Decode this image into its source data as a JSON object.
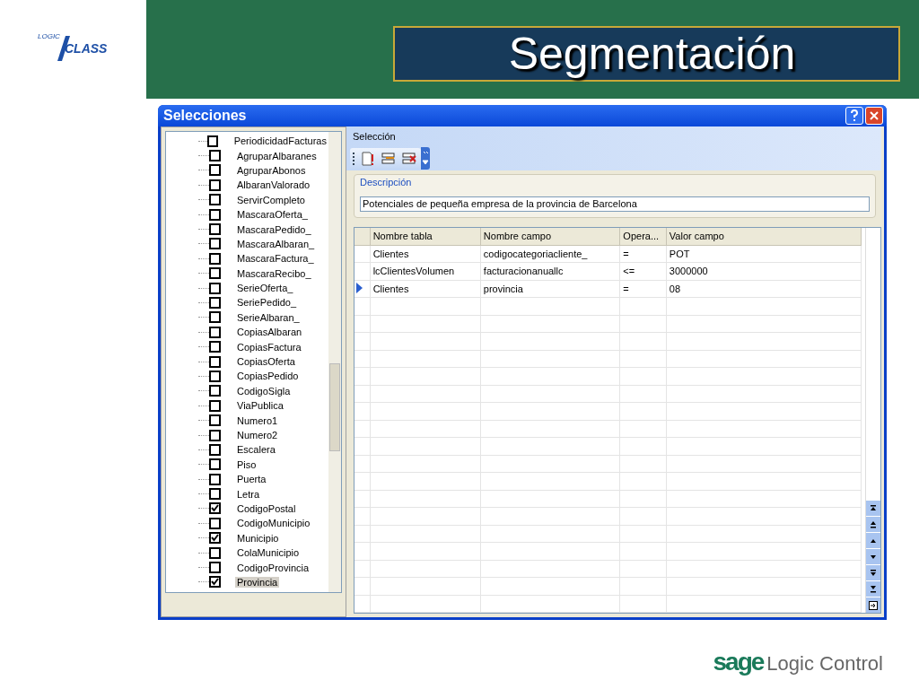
{
  "logo": {
    "top": "LOGIC",
    "main": "CLASS"
  },
  "slide_title": "Segmentación",
  "window": {
    "title": "Selecciones"
  },
  "tree": {
    "items": [
      {
        "label": "PeriodicidadFacturas",
        "checked": false,
        "selected": false
      },
      {
        "label": "AgruparAlbaranes",
        "checked": false,
        "selected": false
      },
      {
        "label": "AgruparAbonos",
        "checked": false,
        "selected": false
      },
      {
        "label": "AlbaranValorado",
        "checked": false,
        "selected": false
      },
      {
        "label": "ServirCompleto",
        "checked": false,
        "selected": false
      },
      {
        "label": "MascaraOferta_",
        "checked": false,
        "selected": false
      },
      {
        "label": "MascaraPedido_",
        "checked": false,
        "selected": false
      },
      {
        "label": "MascaraAlbaran_",
        "checked": false,
        "selected": false
      },
      {
        "label": "MascaraFactura_",
        "checked": false,
        "selected": false
      },
      {
        "label": "MascaraRecibo_",
        "checked": false,
        "selected": false
      },
      {
        "label": "SerieOferta_",
        "checked": false,
        "selected": false
      },
      {
        "label": "SeriePedido_",
        "checked": false,
        "selected": false
      },
      {
        "label": "SerieAlbaran_",
        "checked": false,
        "selected": false
      },
      {
        "label": "CopiasAlbaran",
        "checked": false,
        "selected": false
      },
      {
        "label": "CopiasFactura",
        "checked": false,
        "selected": false
      },
      {
        "label": "CopiasOferta",
        "checked": false,
        "selected": false
      },
      {
        "label": "CopiasPedido",
        "checked": false,
        "selected": false
      },
      {
        "label": "CodigoSigla",
        "checked": false,
        "selected": false
      },
      {
        "label": "ViaPublica",
        "checked": false,
        "selected": false
      },
      {
        "label": "Numero1",
        "checked": false,
        "selected": false
      },
      {
        "label": "Numero2",
        "checked": false,
        "selected": false
      },
      {
        "label": "Escalera",
        "checked": false,
        "selected": false
      },
      {
        "label": "Piso",
        "checked": false,
        "selected": false
      },
      {
        "label": "Puerta",
        "checked": false,
        "selected": false
      },
      {
        "label": "Letra",
        "checked": false,
        "selected": false
      },
      {
        "label": "CodigoPostal",
        "checked": true,
        "selected": false
      },
      {
        "label": "CodigoMunicipio",
        "checked": false,
        "selected": false
      },
      {
        "label": "Municipio",
        "checked": true,
        "selected": false
      },
      {
        "label": "ColaMunicipio",
        "checked": false,
        "selected": false
      },
      {
        "label": "CodigoProvincia",
        "checked": false,
        "selected": false
      },
      {
        "label": "Provincia",
        "checked": true,
        "selected": true
      }
    ]
  },
  "menu": {
    "label": "Selección"
  },
  "description": {
    "label": "Descripción",
    "value": "Potenciales de pequeña empresa de la provincia de Barcelona"
  },
  "grid": {
    "columns": [
      "Nombre tabla",
      "Nombre campo",
      "Opera...",
      "Valor campo"
    ],
    "rows": [
      {
        "cells": [
          "Clientes",
          "codigocategoriacliente_",
          "=",
          "POT"
        ],
        "selected": false
      },
      {
        "cells": [
          "lcClientesVolumen",
          "facturacionanuallc",
          "<=",
          "3000000"
        ],
        "selected": false
      },
      {
        "cells": [
          "Clientes",
          "provincia",
          "=",
          "08"
        ],
        "selected": true
      }
    ]
  },
  "footer_logo": {
    "brand": "sage",
    "product": "Logic Control"
  }
}
